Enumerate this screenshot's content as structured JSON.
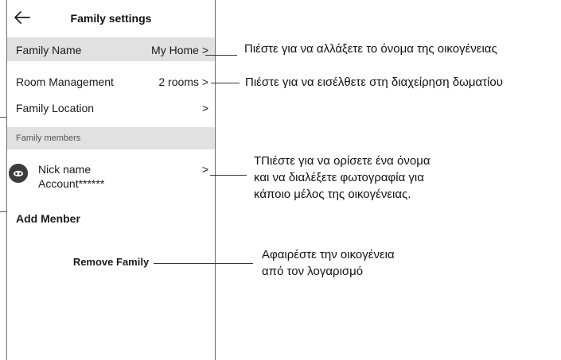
{
  "header": {
    "title": "Family settings",
    "back_icon": "arrow-left-icon"
  },
  "family_name": {
    "label": "Family Name",
    "value": "My Home >"
  },
  "room_management": {
    "label": "Room Management",
    "value": "2 rooms >"
  },
  "family_location": {
    "label": "Family Location",
    "value": ">"
  },
  "members_section": {
    "label": "Family members"
  },
  "member": {
    "name": "Nick name",
    "account": "Account******",
    "chevron": ">",
    "avatar_icon": "user-avatar-icon"
  },
  "add_member": {
    "label": "Add Menber"
  },
  "remove_family": {
    "label": "Remove Family"
  },
  "annotations": {
    "family_name": "Πιέστε για να αλλάξετε το όνομα της οικογένειας",
    "room_management": "Πιέστε για να εισέλθετε στη διαχείρηση δωματίου",
    "member_line1": "ΤΠιέστε για να ορίσετε ένα όνομα",
    "member_line2": "και να διαλέξετε φωτογραφία για",
    "member_line3": "κάποιο μέλος της οικογένειας.",
    "remove_line1": "Αφαιρέστε την οικογένεια",
    "remove_line2": "από τον λογαρισμό"
  }
}
